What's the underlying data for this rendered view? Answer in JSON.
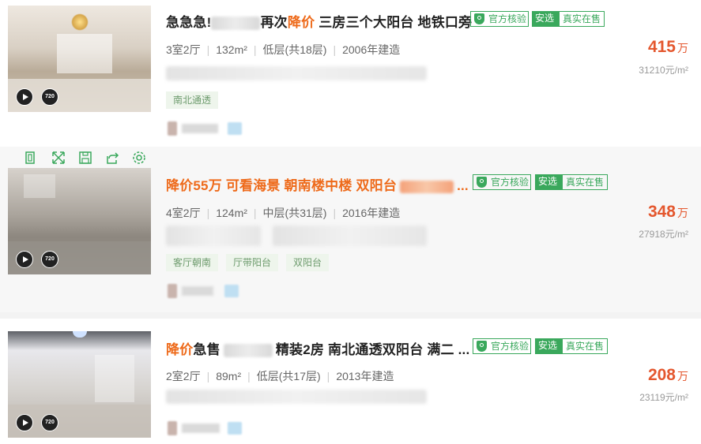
{
  "listings": [
    {
      "title_pre": "急急急!",
      "title_mid": "再次",
      "title_hl": "降价",
      "title_post": " 三房三个大阳台 地铁口旁",
      "badges": {
        "verify": "官方核验",
        "anxuan": "安选",
        "real": "真实在售"
      },
      "info": [
        "3室2厅",
        "132m²",
        "低层(共18层)",
        "2006年建造"
      ],
      "tags": [
        "南北通透"
      ],
      "price": "415",
      "price_unit": "万",
      "unit_price": "31210元/m²",
      "media": {
        "video": "play-icon",
        "panorama": "720"
      }
    },
    {
      "title_main": "降价55万 可看海景 朝南楼中楼 双阳台",
      "title_ellipsis": "...",
      "badges": {
        "verify": "官方核验",
        "anxuan": "安选",
        "real": "真实在售"
      },
      "info": [
        "4室2厅",
        "124m²",
        "中层(共31层)",
        "2016年建造"
      ],
      "tags": [
        "客厅朝南",
        "厅带阳台",
        "双阳台"
      ],
      "price": "348",
      "price_unit": "万",
      "unit_price": "27918元/m²",
      "media": {
        "video": "play-icon",
        "panorama": "720"
      }
    },
    {
      "title_hl": "降价",
      "title_pre": "急售",
      "title_post": "精装2房 南北通透双阳台 满二 ...",
      "badges": {
        "verify": "官方核验",
        "anxuan": "安选",
        "real": "真实在售"
      },
      "info": [
        "2室2厅",
        "89m²",
        "低层(共17层)",
        "2013年建造"
      ],
      "tags": [],
      "price": "208",
      "price_unit": "万",
      "unit_price": "23119元/m²",
      "media": {
        "video": "play-icon",
        "panorama": "720"
      }
    }
  ],
  "hover_toolbar": [
    "compare-icon",
    "expand-icon",
    "save-icon",
    "share-icon",
    "settings-icon"
  ],
  "colors": {
    "accent_green": "#3aa85c",
    "price_red": "#e4572e",
    "title_orange": "#ee6a1a"
  }
}
